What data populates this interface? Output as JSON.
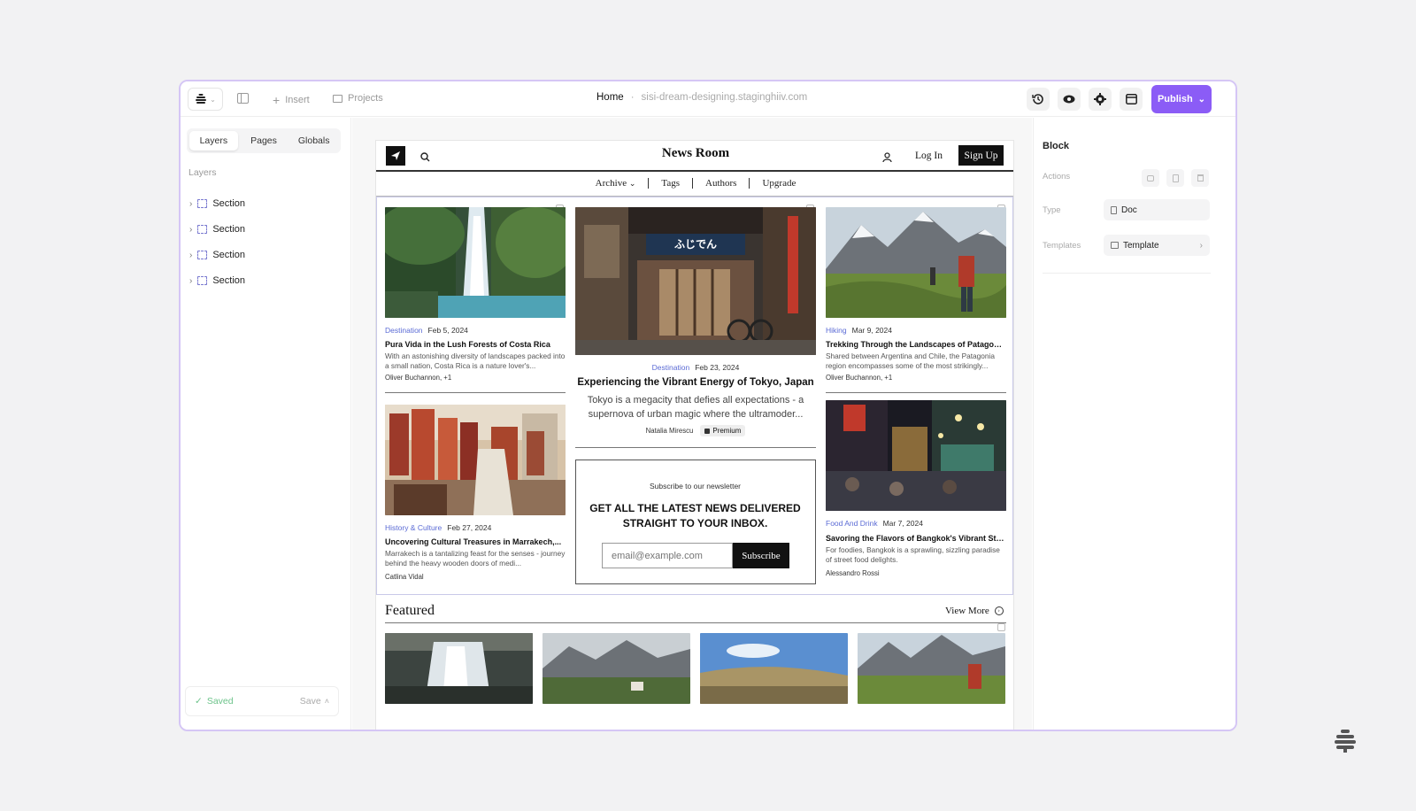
{
  "app": {
    "logo_icon": "beehiiv-logo-icon",
    "toolbar": {
      "insert_label": "Insert",
      "projects_label": "Projects"
    },
    "breadcrumb": {
      "home": "Home",
      "separator": "·",
      "domain": "sisi-dream-designing.staginghiiv.com"
    },
    "right_icons": [
      "history-icon",
      "eye-icon",
      "gear-icon",
      "layout-icon"
    ],
    "publish_label": "Publish",
    "accent": "#8b5cf6"
  },
  "left_panel": {
    "tabs": [
      {
        "label": "Layers"
      },
      {
        "label": "Pages"
      },
      {
        "label": "Globals"
      }
    ],
    "heading": "Layers",
    "layers": [
      {
        "label": "Section"
      },
      {
        "label": "Section"
      },
      {
        "label": "Section"
      },
      {
        "label": "Section"
      }
    ],
    "saved_label": "Saved",
    "save_label": "Save"
  },
  "right_panel": {
    "title": "Block",
    "actions_label": "Actions",
    "type_label": "Type",
    "type_value": "Doc",
    "templates_label": "Templates",
    "templates_value": "Template"
  },
  "site": {
    "brand": "News Room",
    "login": "Log In",
    "signup": "Sign Up",
    "nav": [
      "Archive",
      "Tags",
      "Authors",
      "Upgrade"
    ],
    "articles": {
      "left_top": {
        "category": "Destination",
        "date": "Feb 5, 2024",
        "title": "Pura Vida in the Lush Forests of Costa Rica",
        "excerpt": "With an astonishing diversity of landscapes packed into a small nation, Costa Rica is a nature lover's...",
        "author": "Oliver Buchannon, +1"
      },
      "left_bottom": {
        "category": "History & Culture",
        "date": "Feb 27, 2024",
        "title": "Uncovering Cultural Treasures in Marrakech,...",
        "excerpt": "Marrakech is a tantalizing feast for the senses - journey behind the heavy wooden doors of medi...",
        "author": "Catlina Vidal"
      },
      "center": {
        "category": "Destination",
        "date": "Feb 23, 2024",
        "title": "Experiencing the Vibrant Energy of Tokyo, Japan",
        "excerpt": "Tokyo is a megacity that defies all expectations - a supernova of urban magic where the ultramoder...",
        "author": "Natalia Mirescu",
        "badge": "Premium",
        "sign": "ふじでん"
      },
      "right_top": {
        "category": "Hiking",
        "date": "Mar 9, 2024",
        "title": "Trekking Through the Landscapes of Patagonia,...",
        "excerpt": "Shared between Argentina and Chile, the Patagonia region encompasses some of the most strikingly...",
        "author": "Oliver Buchannon, +1"
      },
      "right_bottom": {
        "category": "Food And Drink",
        "date": "Mar 7, 2024",
        "title": "Savoring the Flavors of Bangkok's Vibrant Street...",
        "excerpt": "For foodies, Bangkok is a sprawling, sizzling paradise of street food delights.",
        "author": "Alessandro Rossi"
      }
    },
    "newsletter": {
      "kicker": "Subscribe to our newsletter",
      "headline_1": "GET ALL THE LATEST NEWS DELIVERED",
      "headline_2": "STRAIGHT TO YOUR INBOX.",
      "placeholder": "email@example.com",
      "button": "Subscribe"
    },
    "featured": {
      "title": "Featured",
      "view_more": "View More"
    }
  }
}
